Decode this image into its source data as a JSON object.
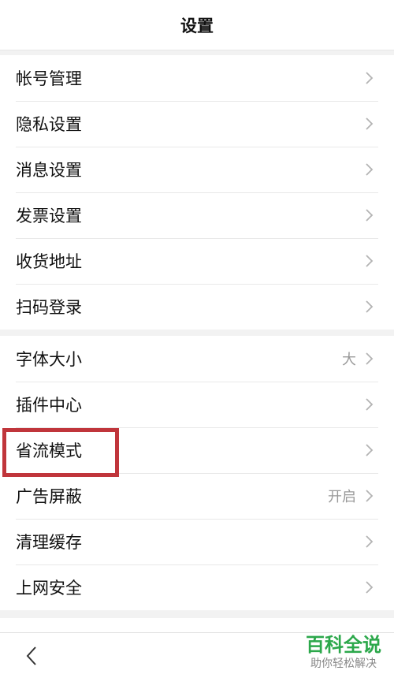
{
  "header": {
    "title": "设置"
  },
  "groups": [
    {
      "items": [
        {
          "label": "帐号管理",
          "value": ""
        },
        {
          "label": "隐私设置",
          "value": ""
        },
        {
          "label": "消息设置",
          "value": ""
        },
        {
          "label": "发票设置",
          "value": ""
        },
        {
          "label": "收货地址",
          "value": ""
        },
        {
          "label": "扫码登录",
          "value": ""
        }
      ]
    },
    {
      "items": [
        {
          "label": "字体大小",
          "value": "大"
        },
        {
          "label": "插件中心",
          "value": ""
        },
        {
          "label": "省流模式",
          "value": ""
        },
        {
          "label": "广告屏蔽",
          "value": "开启"
        },
        {
          "label": "清理缓存",
          "value": ""
        },
        {
          "label": "上网安全",
          "value": ""
        }
      ]
    }
  ],
  "icons": {
    "row_arrow": "chevron-right-icon",
    "back": "back-arrow-icon"
  },
  "colors": {
    "highlight": "#c0353b",
    "watermark": "#2ca84b"
  },
  "watermark": {
    "title": "百科全说",
    "subtitle": "助你轻松解决"
  }
}
